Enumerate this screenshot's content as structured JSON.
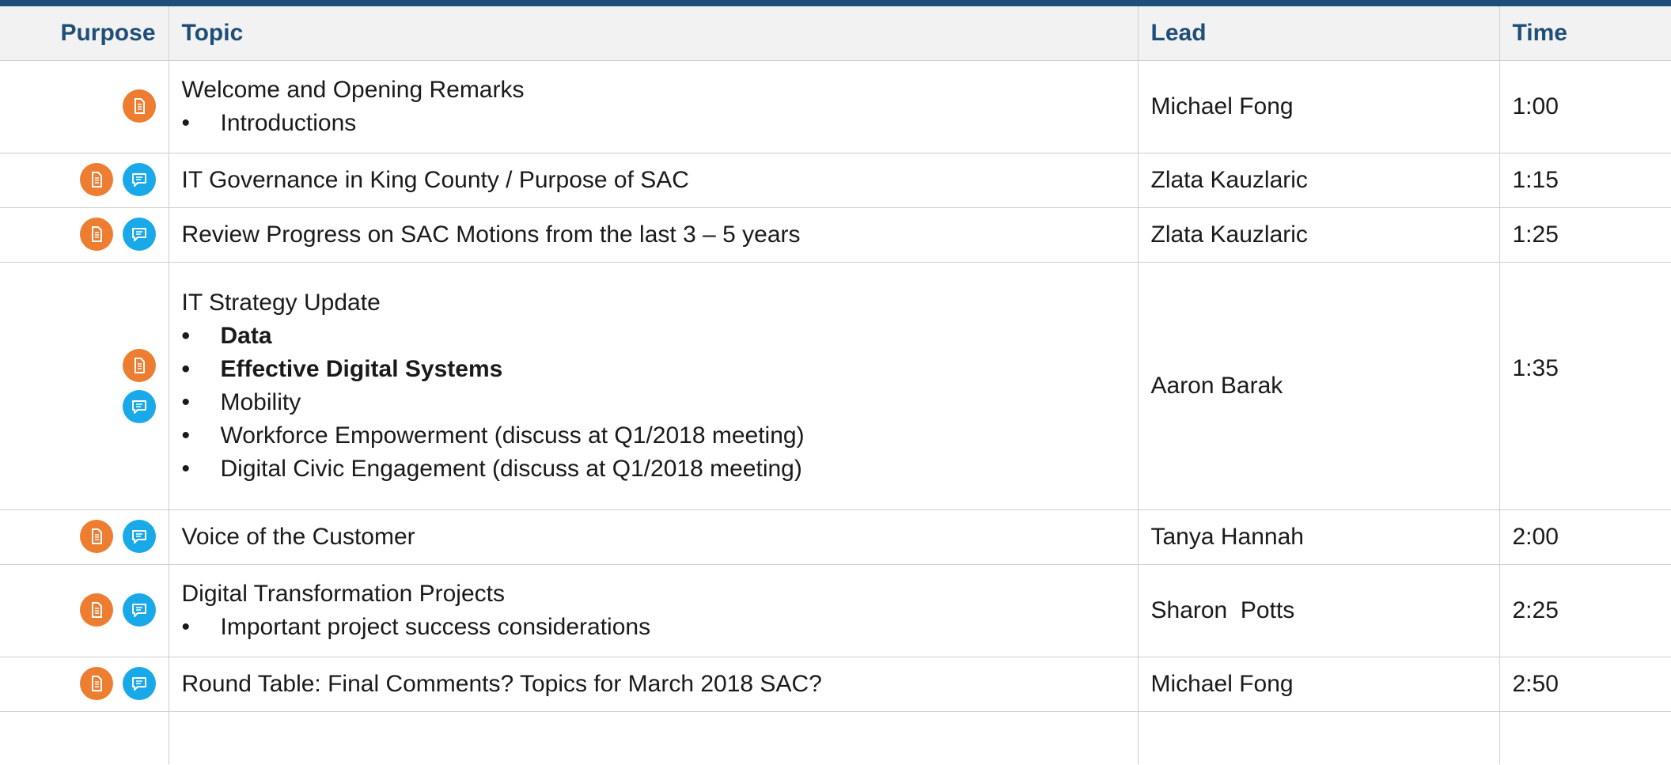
{
  "columns": {
    "purpose": "Purpose",
    "topic": "Topic",
    "lead": "Lead",
    "time": "Time"
  },
  "icon_colors": {
    "document": "#ed7d31",
    "discussion": "#1aa9e8",
    "header_text": "#1f4e79",
    "top_bar": "#1f4e79"
  },
  "rows": [
    {
      "icons": [
        "document-icon"
      ],
      "topic": "Welcome and Opening Remarks",
      "bullets": [
        "Introductions"
      ],
      "lead": "Michael Fong",
      "time": "1:00"
    },
    {
      "icons": [
        "document-icon",
        "discussion-icon"
      ],
      "topic": "IT Governance in King County / Purpose of SAC",
      "bullets": [],
      "lead": "Zlata Kauzlaric",
      "time": "1:15"
    },
    {
      "icons": [
        "document-icon",
        "discussion-icon"
      ],
      "topic": "Review Progress on SAC Motions from the last 3 – 5 years",
      "bullets": [],
      "lead": "Zlata Kauzlaric",
      "time": "1:25"
    },
    {
      "icons": [
        "document-icon",
        "discussion-icon"
      ],
      "topic": "IT Strategy Update",
      "bullets": [
        "Data",
        "Effective Digital Systems",
        "Mobility",
        "Workforce Empowerment (discuss at  Q1/2018 meeting)",
        "Digital Civic Engagement (discuss at Q1/2018 meeting)"
      ],
      "bold_bullets": [
        "Data",
        "Effective Digital Systems"
      ],
      "lead": "Aaron Barak",
      "time": "1:35"
    },
    {
      "icons": [
        "document-icon",
        "discussion-icon"
      ],
      "topic": "Voice of the Customer",
      "bullets": [],
      "lead": "Tanya Hannah",
      "time": "2:00"
    },
    {
      "icons": [
        "document-icon",
        "discussion-icon"
      ],
      "topic": "Digital Transformation Projects",
      "bullets": [
        "Important project success considerations"
      ],
      "lead": "Sharon  Potts",
      "time": "2:25"
    },
    {
      "icons": [
        "document-icon",
        "discussion-icon"
      ],
      "topic": "Round Table: Final Comments? Topics for March 2018 SAC?",
      "bullets": [],
      "lead": "Michael Fong",
      "time": "2:50"
    }
  ]
}
